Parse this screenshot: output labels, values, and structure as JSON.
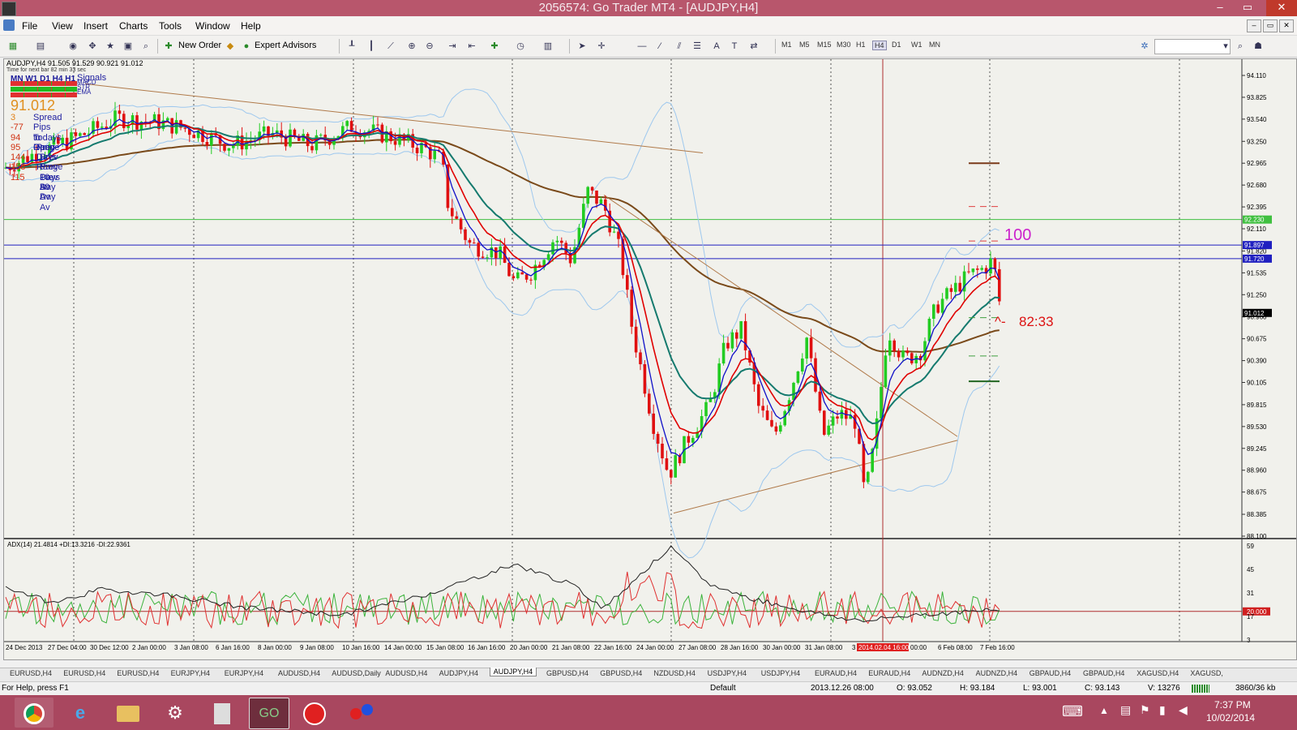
{
  "window": {
    "title": "2056574: Go Trader MT4 - [AUDJPY,H4]",
    "min_label": "–",
    "max_label": "▭",
    "close_label": "✕"
  },
  "menu": {
    "items": [
      "File",
      "View",
      "Insert",
      "Charts",
      "Tools",
      "Window",
      "Help"
    ],
    "mdi_controls": [
      "–",
      "▭",
      "✕"
    ]
  },
  "toolbar": {
    "new_order": "New Order",
    "expert_advisors": "Expert Advisors",
    "timeframes": [
      "M1",
      "M5",
      "M15",
      "M30",
      "H1",
      "H4",
      "D1",
      "W1",
      "MN"
    ],
    "active_timeframe": "H4"
  },
  "chart": {
    "header": "AUDJPY,H4  91.505 91.529 90.921 91.012",
    "timer_note": "Time for next bar 82 min 33 sec",
    "mtf_labels": "MN W1 D1  H4  H1",
    "signals_title": "Signals",
    "signals_rows": [
      "MACD",
      "STR",
      "EMA"
    ],
    "big_price": "91.012",
    "info_rows": [
      {
        "value": "3",
        "label": "Spread"
      },
      {
        "value": "-77",
        "label": "Pips to Open"
      },
      {
        "value": "94",
        "label": "Todays Range"
      },
      {
        "value": "95",
        "label": "Prev Days Range"
      },
      {
        "value": "144",
        "label": "Prev 5 Days Av"
      },
      {
        "value": "158",
        "label": "Prev 10 Day Av"
      },
      {
        "value": "115",
        "label": "Prev 30 Day Av"
      }
    ],
    "annot_100": "100",
    "annot_timer": "82:33",
    "price_axis": [
      "94.110",
      "93.825",
      "93.540",
      "93.250",
      "92.965",
      "92.680",
      "92.395",
      "92.110",
      "91.820",
      "91.535",
      "91.250",
      "90.960",
      "90.675",
      "90.390",
      "90.105",
      "89.815",
      "89.530",
      "89.245",
      "88.960",
      "88.675",
      "88.385",
      "88.100"
    ],
    "price_tags": {
      "green": "92.230",
      "blue1": "91.897",
      "blue2": "91.720",
      "current": "91.012"
    },
    "adx_label": "ADX(14) 21.4814 +DI:13.3216 -DI:22.9361",
    "adx_axis": [
      "59",
      "45",
      "31",
      "20.000",
      "17",
      "3"
    ],
    "time_axis": [
      "24 Dec 2013",
      "27 Dec 04:00",
      "30 Dec 12:00",
      "2 Jan 00:00",
      "3 Jan 08:00",
      "6 Jan 16:00",
      "8 Jan 00:00",
      "9 Jan 08:00",
      "10 Jan 16:00",
      "14 Jan 00:00",
      "15 Jan 08:00",
      "16 Jan 16:00",
      "20 Jan 00:00",
      "21 Jan 08:00",
      "22 Jan 16:00",
      "24 Jan 00:00",
      "27 Jan 08:00",
      "28 Jan 16:00",
      "30 Jan 00:00",
      "31 Jan 08:00",
      "3",
      "2014.02.04 16:00",
      "00:00",
      "6 Feb 08:00",
      "7 Feb 16:00"
    ]
  },
  "colors": {
    "bull": "#22cc22",
    "bear": "#e01010",
    "ema_red": "#e00000",
    "ema_blue": "#1010c8",
    "ema_teal": "#157a6e",
    "ma200": "#7a4a1a",
    "bands": "#9ec8ee",
    "trend": "#b07a4a",
    "magenta": "#cc22cc"
  },
  "tabs": [
    "EURUSD,H4",
    "EURUSD,H4",
    "EURUSD,H4",
    "EURJPY,H4",
    "EURJPY,H4",
    "AUDUSD,H4",
    "AUDUSD,Daily",
    "AUDUSD,H4",
    "AUDJPY,H4",
    "AUDJPY,H4",
    "GBPUSD,H4",
    "GBPUSD,H4",
    "NZDUSD,H4",
    "USDJPY,H4",
    "USDJPY,H4",
    "EURAUD,H4",
    "EURAUD,H4",
    "AUDNZD,H4",
    "AUDNZD,H4",
    "GBPAUD,H4",
    "GBPAUD,H4",
    "XAGUSD,H4",
    "XAGUSD,"
  ],
  "active_tab": 9,
  "status": {
    "help": "For Help, press F1",
    "profile": "Default",
    "time": "2013.12.26 08:00",
    "open": "O: 93.052",
    "high": "H: 93.184",
    "low": "L: 93.001",
    "close": "C: 93.143",
    "volume": "V: 13276",
    "traffic": "3860/36 kb"
  },
  "taskbar": {
    "clock_time": "7:37 PM",
    "clock_date": "10/02/2014"
  }
}
